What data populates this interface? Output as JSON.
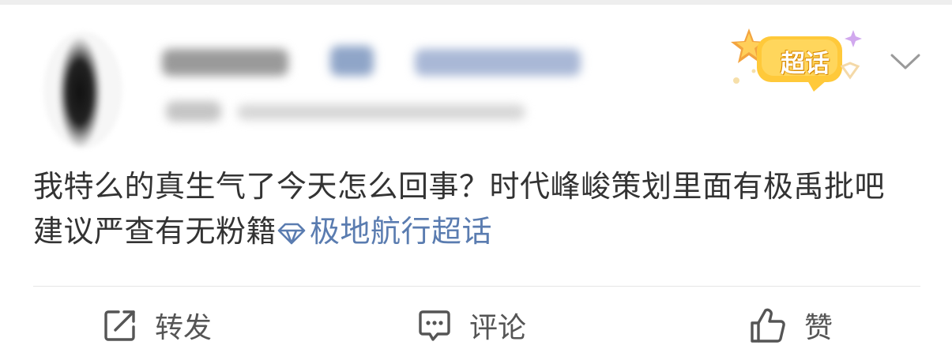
{
  "post": {
    "author": {
      "avatar_icon": "avatar-blurred",
      "name_redacted": true,
      "meta_redacted": true
    },
    "badge": {
      "label": "超话",
      "colors": {
        "main": "#ffc93a",
        "star": "#f0a040",
        "sparkle": "#c8a0e8"
      }
    },
    "menu_icon": "chevron-down-icon",
    "content": {
      "text": "我特么的真生气了今天怎么回事？时代峰峻策划里面有极禹批吧 建议严查有无粉籍",
      "topic": "极地航行超话",
      "topic_icon": "diamond-icon",
      "topic_color": "#5a7cb0"
    }
  },
  "actions": [
    {
      "label": "转发",
      "icon": "repost-icon"
    },
    {
      "label": "评论",
      "icon": "comment-icon"
    },
    {
      "label": "赞",
      "icon": "like-icon"
    }
  ]
}
